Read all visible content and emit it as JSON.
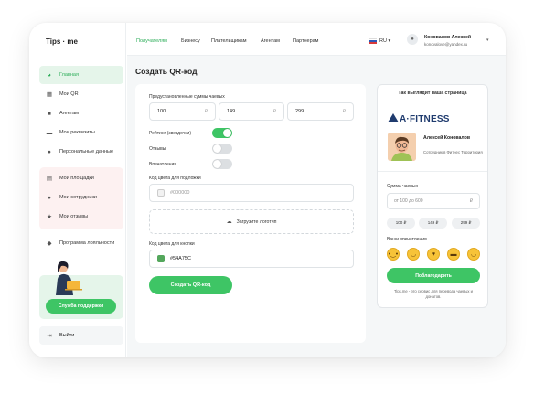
{
  "app": {
    "logo": "Tips · me"
  },
  "sidebar": {
    "items": [
      {
        "label": "Главная",
        "icon": "pie-chart-icon"
      },
      {
        "label": "Мои QR",
        "icon": "qr-icon"
      },
      {
        "label": "Агентам",
        "icon": "briefcase-icon"
      },
      {
        "label": "Мои реквизиты",
        "icon": "card-icon"
      },
      {
        "label": "Персональные данные",
        "icon": "user-icon"
      },
      {
        "label": "Мои площадки",
        "icon": "document-icon"
      },
      {
        "label": "Мои сотрудники",
        "icon": "users-icon"
      },
      {
        "label": "Мои отзывы",
        "icon": "star-icon"
      },
      {
        "label": "Программа лояльности",
        "icon": "tag-icon"
      }
    ],
    "support_label": "Служба поддержки",
    "logout_label": "Выйти"
  },
  "header": {
    "nav": [
      "Получателям",
      "Бизнесу",
      "Плательщикам",
      "Агентам",
      "Партнерам"
    ],
    "lang": "RU",
    "user_name": "Коновалов Алексей",
    "user_email": "konovalove@yandex.ru"
  },
  "main": {
    "title": "Создать QR-код",
    "preset_label": "Предустановленные суммы чаевых",
    "presets": [
      "100",
      "149",
      "299"
    ],
    "currency": "₽",
    "toggles": [
      {
        "label": "Рейтинг (звездочки)",
        "on": true
      },
      {
        "label": "Отзывы",
        "on": false
      },
      {
        "label": "Впечатления",
        "on": false
      }
    ],
    "bg_color_label": "Код цвета для подложки",
    "bg_color_placeholder": "#000000",
    "upload_label": "Загрузите логотип",
    "btn_color_label": "Код цвета для кнопки",
    "btn_color_value": "#54A75C",
    "create_label": "Создать QR-код"
  },
  "preview": {
    "header": "Так выглядит ваша страница",
    "brand": "A·FITNESS",
    "employee_name": "Алексей Коновалов",
    "employee_role": "Сотрудник в Фитнес Территория",
    "tip_label": "Сумма чаевых",
    "tip_placeholder": "от 100 до 600",
    "chips": [
      "100 ₽",
      "149 ₽",
      "299 ₽"
    ],
    "impressions_label": "Ваши впечатления",
    "thank_label": "Поблагодарить",
    "footer": "Tips.me - это сервис для перевода чаевых и донатов."
  },
  "colors": {
    "accent": "#3ec565",
    "active_bg": "#e5f5ea",
    "brand": "#1f3b6e",
    "button_color": "#54A75C"
  }
}
